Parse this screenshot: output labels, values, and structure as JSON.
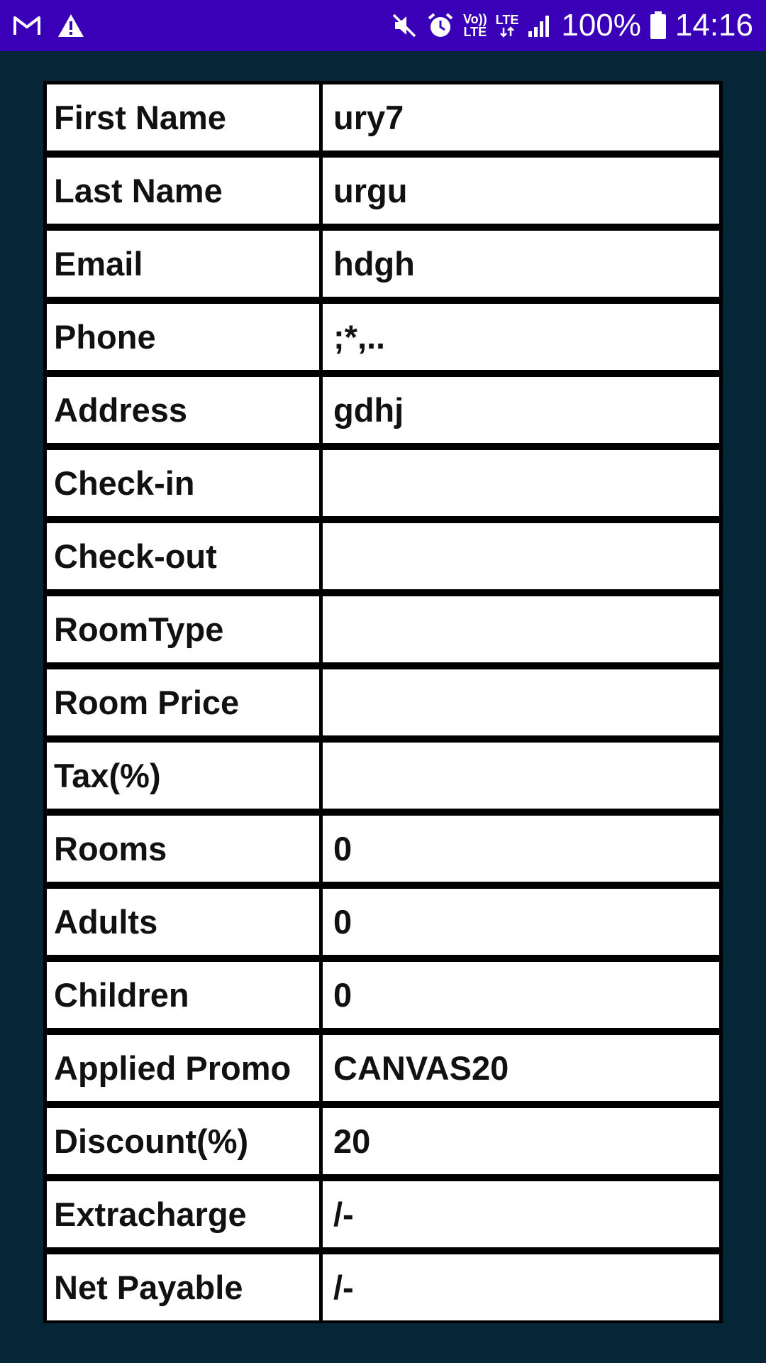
{
  "status_bar": {
    "battery": "100%",
    "time": "14:16",
    "volte": "Vo))\nLTE",
    "lte": "LTE"
  },
  "table": {
    "rows": [
      {
        "label": "First Name",
        "value": "ury7"
      },
      {
        "label": "Last Name",
        "value": "urgu"
      },
      {
        "label": "Email",
        "value": "hdgh"
      },
      {
        "label": "Phone",
        "value": ";*,.."
      },
      {
        "label": "Address",
        "value": "gdhj"
      },
      {
        "label": "Check-in",
        "value": ""
      },
      {
        "label": "Check-out",
        "value": ""
      },
      {
        "label": "RoomType",
        "value": ""
      },
      {
        "label": "Room Price",
        "value": ""
      },
      {
        "label": "Tax(%)",
        "value": ""
      },
      {
        "label": "Rooms",
        "value": "0"
      },
      {
        "label": "Adults",
        "value": "0"
      },
      {
        "label": "Children",
        "value": "0"
      },
      {
        "label": "Applied Promo",
        "value": "CANVAS20"
      },
      {
        "label": "Discount(%)",
        "value": "20"
      },
      {
        "label": "Extracharge",
        "value": "/-"
      },
      {
        "label": "Net Payable",
        "value": "/-"
      }
    ]
  }
}
